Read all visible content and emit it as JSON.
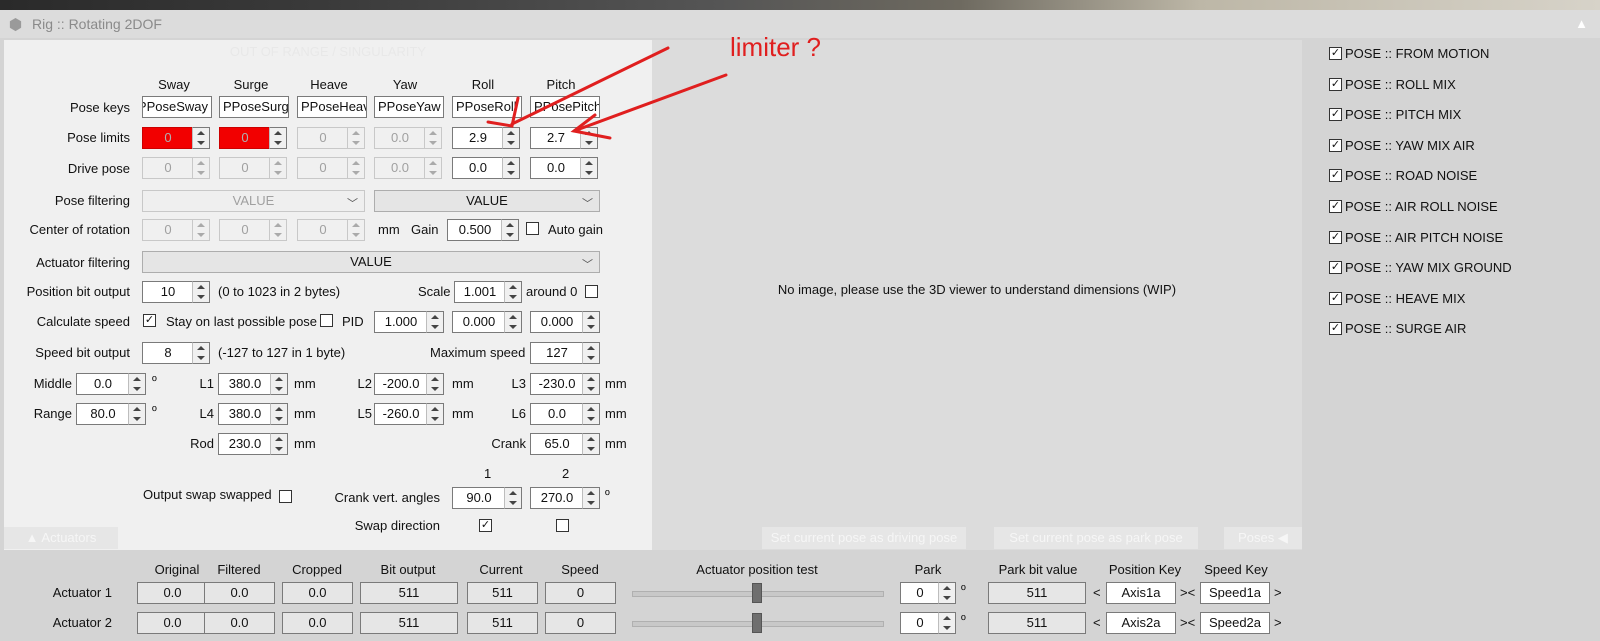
{
  "window": {
    "title": "Rig :: Rotating 2DOF",
    "status_banner": "OUT OF RANGE / SINGULARITY"
  },
  "annotation": {
    "text": "limiter ?"
  },
  "columns": [
    "Sway",
    "Surge",
    "Heave",
    "Yaw",
    "Roll",
    "Pitch"
  ],
  "pose_keys": {
    "label": "Pose keys",
    "values": [
      "PPoseSway",
      "PPoseSurge",
      "PPoseHeave",
      "PPoseYaw",
      "PPoseRoll",
      "PPosePitch"
    ]
  },
  "pose_limits": {
    "label": "Pose limits",
    "values": [
      "0",
      "0",
      "0",
      "0.0",
      "2.9",
      "2.7"
    ]
  },
  "drive_pose": {
    "label": "Drive pose",
    "values": [
      "0",
      "0",
      "0",
      "0.0",
      "0.0",
      "0.0"
    ]
  },
  "pose_filtering": {
    "label": "Pose filtering",
    "combo1": "VALUE",
    "combo2": "VALUE"
  },
  "center_of_rotation": {
    "label": "Center of rotation",
    "values": [
      "0",
      "0",
      "0"
    ],
    "unit": "mm",
    "gain_label": "Gain",
    "gain": "0.500",
    "auto_gain_label": "Auto gain"
  },
  "actuator_filtering": {
    "label": "Actuator filtering",
    "value": "VALUE"
  },
  "position_bit_output": {
    "label": "Position bit output",
    "value": "10",
    "hint": "(0 to 1023 in 2 bytes)",
    "scale_label": "Scale",
    "scale": "1.001",
    "around0_label": "around 0"
  },
  "calculate_speed": {
    "label": "Calculate speed",
    "stay_label": "Stay on last possible pose",
    "pid_label": "PID",
    "pid_values": [
      "1.000",
      "0.000",
      "0.000"
    ]
  },
  "speed_bit_output": {
    "label": "Speed bit output",
    "value": "8",
    "hint": "(-127 to 127 in 1 byte)",
    "max_speed_label": "Maximum speed",
    "max_speed": "127"
  },
  "geometry": {
    "middle_label": "Middle",
    "middle": "0.0",
    "range_label": "Range",
    "range": "80.0",
    "deg": "º",
    "mm": "mm",
    "l1_label": "L1",
    "l1": "380.0",
    "l2_label": "L2",
    "l2": "-200.0",
    "l3_label": "L3",
    "l3": "-230.0",
    "l4_label": "L4",
    "l4": "380.0",
    "l5_label": "L5",
    "l5": "-260.0",
    "l6_label": "L6",
    "l6": "0.0",
    "rod_label": "Rod",
    "rod": "230.0",
    "crank_label": "Crank",
    "crank": "65.0"
  },
  "crank": {
    "col1": "1",
    "col2": "2",
    "output_swap_label": "Output swap swapped",
    "vert_label": "Crank vert. angles",
    "angle1": "90.0",
    "angle2": "270.0",
    "swap_dir_label": "Swap direction"
  },
  "center": {
    "no_image": "No image, please use the 3D viewer to understand dimensions (WIP)"
  },
  "poses": [
    "POSE :: FROM MOTION",
    "POSE :: ROLL MIX",
    "POSE :: PITCH MIX",
    "POSE :: YAW MIX AIR",
    "POSE :: ROAD NOISE",
    "POSE :: AIR ROLL NOISE",
    "POSE :: AIR PITCH NOISE",
    "POSE :: YAW MIX GROUND",
    "POSE :: HEAVE MIX",
    "POSE :: SURGE AIR"
  ],
  "bottom": {
    "actuators_tab": "▲  Actuators",
    "set_driving": "Set current pose as driving pose",
    "set_park": "Set current pose as park pose",
    "poses_btn": "Poses  ◀",
    "headers": {
      "original": "Original",
      "filtered": "Filtered",
      "cropped": "Cropped",
      "bit_output": "Bit output",
      "current": "Current",
      "speed": "Speed",
      "position_test": "Actuator position test",
      "park": "Park",
      "park_bit": "Park bit value",
      "position_key": "Position Key",
      "speed_key": "Speed Key"
    },
    "rows": [
      {
        "name": "Actuator 1",
        "original": "0.0",
        "filtered": "0.0",
        "cropped": "0.0",
        "bit": "511",
        "current": "511",
        "speed": "0",
        "slider": 0.5,
        "park": "0",
        "park_bit": "511",
        "pos_key": "Axis1a",
        "speed_key": "Speed1a"
      },
      {
        "name": "Actuator 2",
        "original": "0.0",
        "filtered": "0.0",
        "cropped": "0.0",
        "bit": "511",
        "current": "511",
        "speed": "0",
        "slider": 0.5,
        "park": "0",
        "park_bit": "511",
        "pos_key": "Axis2a",
        "speed_key": "Speed2a"
      }
    ]
  }
}
